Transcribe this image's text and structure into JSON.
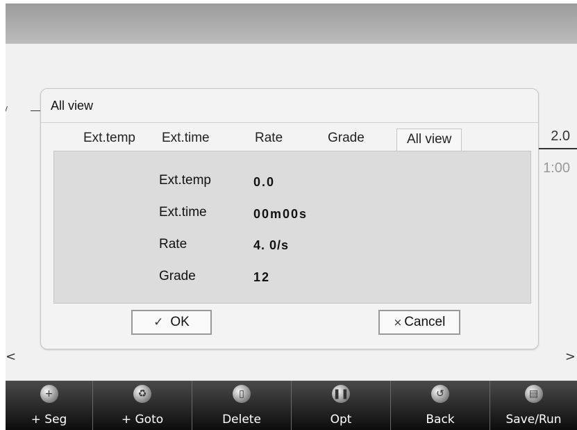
{
  "dialog": {
    "title": "All view",
    "tabs": [
      {
        "label": "Ext.temp",
        "active": false
      },
      {
        "label": "Ext.time",
        "active": false
      },
      {
        "label": "Rate",
        "active": false
      },
      {
        "label": "Grade",
        "active": false
      },
      {
        "label": "All view",
        "active": true
      }
    ],
    "rows": [
      {
        "label": "Ext.temp",
        "value": "0.0"
      },
      {
        "label": "Ext.time",
        "value": "00m00s"
      },
      {
        "label": "Rate",
        "value": "4. 0/s"
      },
      {
        "label": "Grade",
        "value": "12"
      }
    ],
    "ok": {
      "icon": "✓",
      "label": "OK"
    },
    "cancel": {
      "icon": "×",
      "label": "Cancel"
    }
  },
  "background": {
    "value_top": "2.0",
    "value_bottom": "1:00",
    "prev_arrow": "<",
    "next_arrow": ">"
  },
  "toolbar": [
    {
      "label": "+ Seg",
      "icon": "add-segment-icon",
      "glyph": "+"
    },
    {
      "label": "+ Goto",
      "icon": "recycle-icon",
      "glyph": "♻"
    },
    {
      "label": "Delete",
      "icon": "trash-icon",
      "glyph": "▯"
    },
    {
      "label": "Opt",
      "icon": "pause-icon",
      "glyph": "❚❚"
    },
    {
      "label": "Back",
      "icon": "back-icon",
      "glyph": "↺"
    },
    {
      "label": "Save/Run",
      "icon": "save-run-icon",
      "glyph": "▤"
    }
  ],
  "colors": {
    "top_bar": "#a9a9a9",
    "screen_bg": "#f1f1f1",
    "panel_bg": "#dcdcdc",
    "toolbar_bg": "#1e1e1e"
  }
}
